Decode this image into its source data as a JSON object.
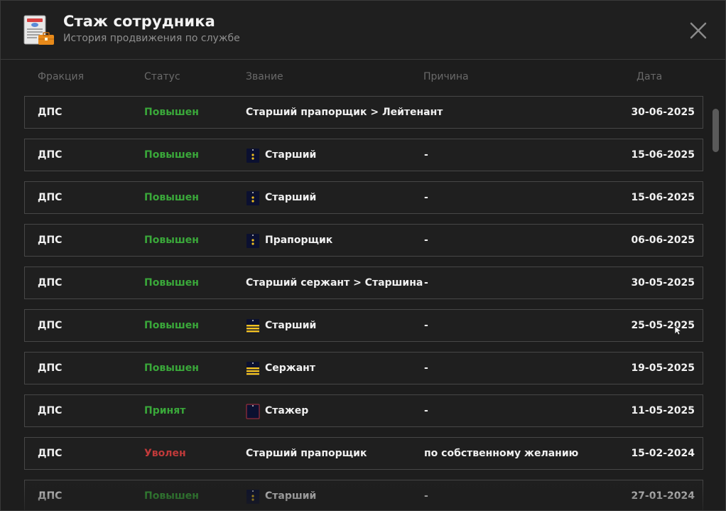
{
  "header": {
    "title": "Стаж сотрудника",
    "subtitle": "История продвижения по службе",
    "icon": "document-briefcase-icon",
    "close_icon": "close-icon"
  },
  "columns": {
    "faction": "Фракция",
    "status": "Статус",
    "rank": "Звание",
    "reason": "Причина",
    "date": "Дата"
  },
  "colors": {
    "promoted": "#3aa83a",
    "accepted": "#3aa83a",
    "fired": "#c03a3a",
    "accent_gold": "#f0c020",
    "badge_navy": "#0b1030"
  },
  "rows": [
    {
      "faction": "ДПС",
      "status": "Повышен",
      "status_type": "promoted",
      "rank": "Старший прапорщик > Лейтенант",
      "reason": "-",
      "date": "30-06-2025",
      "icon": ""
    },
    {
      "faction": "ДПС",
      "status": "Повышен",
      "status_type": "promoted",
      "rank": "Старший",
      "reason": "-",
      "date": "15-06-2025",
      "icon": "star-epaulette-icon"
    },
    {
      "faction": "ДПС",
      "status": "Повышен",
      "status_type": "promoted",
      "rank": "Старший",
      "reason": "-",
      "date": "15-06-2025",
      "icon": "star-epaulette-icon"
    },
    {
      "faction": "ДПС",
      "status": "Повышен",
      "status_type": "promoted",
      "rank": "Прапорщик",
      "reason": "-",
      "date": "06-06-2025",
      "icon": "star-epaulette-icon"
    },
    {
      "faction": "ДПС",
      "status": "Повышен",
      "status_type": "promoted",
      "rank": "Старший сержант > Старшина",
      "reason": "-",
      "date": "30-05-2025",
      "icon": ""
    },
    {
      "faction": "ДПС",
      "status": "Повышен",
      "status_type": "promoted",
      "rank": "Старший",
      "reason": "-",
      "date": "25-05-2025",
      "icon": "stripes-epaulette-icon"
    },
    {
      "faction": "ДПС",
      "status": "Повышен",
      "status_type": "promoted",
      "rank": "Сержант",
      "reason": "-",
      "date": "19-05-2025",
      "icon": "stripes-epaulette-icon"
    },
    {
      "faction": "ДПС",
      "status": "Принят",
      "status_type": "accepted",
      "rank": "Стажер",
      "reason": "-",
      "date": "11-05-2025",
      "icon": "plain-epaulette-icon"
    },
    {
      "faction": "ДПС",
      "status": "Уволен",
      "status_type": "fired",
      "rank": "Старший прапорщик",
      "reason": "по собственному желанию",
      "date": "15-02-2024",
      "icon": ""
    },
    {
      "faction": "ДПС",
      "status": "Повышен",
      "status_type": "promoted",
      "rank": "Старший",
      "reason": "-",
      "date": "27-01-2024",
      "icon": "star-epaulette-icon"
    }
  ]
}
